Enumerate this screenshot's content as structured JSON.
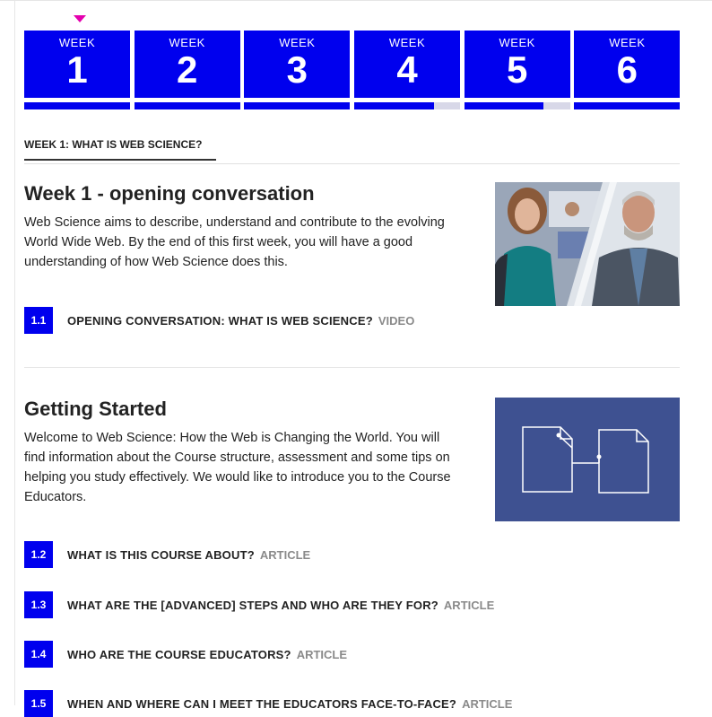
{
  "weeks": [
    {
      "label": "WEEK",
      "number": "1",
      "progress": 1.0
    },
    {
      "label": "WEEK",
      "number": "2",
      "progress": 1.0
    },
    {
      "label": "WEEK",
      "number": "3",
      "progress": 1.0
    },
    {
      "label": "WEEK",
      "number": "4",
      "progress": 0.75
    },
    {
      "label": "WEEK",
      "number": "5",
      "progress": 0.75
    },
    {
      "label": "WEEK",
      "number": "6",
      "progress": 1.0
    }
  ],
  "activity_tab": "WEEK 1: WHAT IS WEB SCIENCE?",
  "sections": [
    {
      "title": "Week 1 - opening conversation",
      "description": "Web Science aims to describe, understand and contribute to the evolving World Wide Web. By the end of this first week, you will have a good understanding of how Web Science does this.",
      "steps": [
        {
          "number": "1.1",
          "title": "OPENING CONVERSATION: WHAT IS WEB SCIENCE?",
          "type": "VIDEO"
        }
      ]
    },
    {
      "title": "Getting Started",
      "description": "Welcome to Web Science: How the Web is Changing the World. You will find information about the Course structure, assessment and some tips on helping you study effectively. We would like to introduce you to the Course Educators.",
      "steps": [
        {
          "number": "1.2",
          "title": "WHAT IS THIS COURSE ABOUT?",
          "type": "ARTICLE"
        },
        {
          "number": "1.3",
          "title": "WHAT ARE THE [ADVANCED] STEPS AND WHO ARE THEY FOR?",
          "type": "ARTICLE"
        },
        {
          "number": "1.4",
          "title": "WHO ARE THE COURSE EDUCATORS?",
          "type": "ARTICLE"
        },
        {
          "number": "1.5",
          "title": "WHEN AND WHERE CAN I MEET THE EDUCATORS FACE-TO-FACE?",
          "type": "ARTICLE"
        }
      ]
    }
  ],
  "colors": {
    "accent": "#0000ee",
    "marker": "#e400ae",
    "thumb_bg": "#3e5191",
    "muted": "#8a8a8a"
  }
}
